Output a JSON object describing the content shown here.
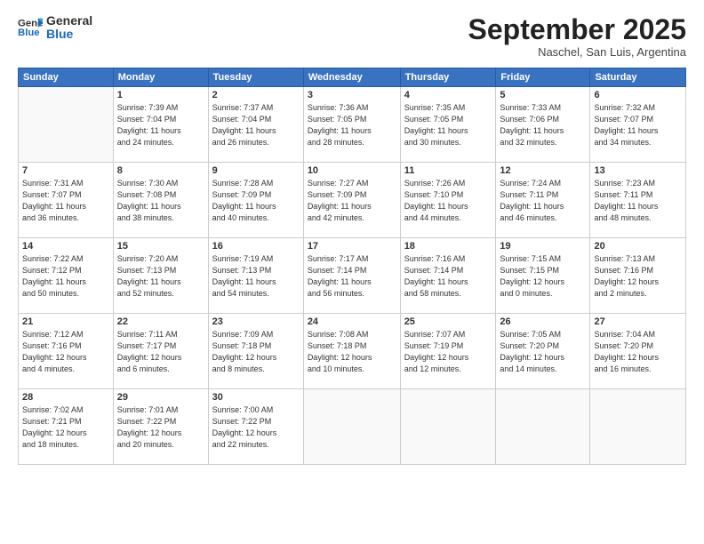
{
  "header": {
    "logo_general": "General",
    "logo_blue": "Blue",
    "month_title": "September 2025",
    "subtitle": "Naschel, San Luis, Argentina"
  },
  "days_of_week": [
    "Sunday",
    "Monday",
    "Tuesday",
    "Wednesday",
    "Thursday",
    "Friday",
    "Saturday"
  ],
  "weeks": [
    [
      {
        "day": "",
        "info": ""
      },
      {
        "day": "1",
        "info": "Sunrise: 7:39 AM\nSunset: 7:04 PM\nDaylight: 11 hours\nand 24 minutes."
      },
      {
        "day": "2",
        "info": "Sunrise: 7:37 AM\nSunset: 7:04 PM\nDaylight: 11 hours\nand 26 minutes."
      },
      {
        "day": "3",
        "info": "Sunrise: 7:36 AM\nSunset: 7:05 PM\nDaylight: 11 hours\nand 28 minutes."
      },
      {
        "day": "4",
        "info": "Sunrise: 7:35 AM\nSunset: 7:05 PM\nDaylight: 11 hours\nand 30 minutes."
      },
      {
        "day": "5",
        "info": "Sunrise: 7:33 AM\nSunset: 7:06 PM\nDaylight: 11 hours\nand 32 minutes."
      },
      {
        "day": "6",
        "info": "Sunrise: 7:32 AM\nSunset: 7:07 PM\nDaylight: 11 hours\nand 34 minutes."
      }
    ],
    [
      {
        "day": "7",
        "info": "Sunrise: 7:31 AM\nSunset: 7:07 PM\nDaylight: 11 hours\nand 36 minutes."
      },
      {
        "day": "8",
        "info": "Sunrise: 7:30 AM\nSunset: 7:08 PM\nDaylight: 11 hours\nand 38 minutes."
      },
      {
        "day": "9",
        "info": "Sunrise: 7:28 AM\nSunset: 7:09 PM\nDaylight: 11 hours\nand 40 minutes."
      },
      {
        "day": "10",
        "info": "Sunrise: 7:27 AM\nSunset: 7:09 PM\nDaylight: 11 hours\nand 42 minutes."
      },
      {
        "day": "11",
        "info": "Sunrise: 7:26 AM\nSunset: 7:10 PM\nDaylight: 11 hours\nand 44 minutes."
      },
      {
        "day": "12",
        "info": "Sunrise: 7:24 AM\nSunset: 7:11 PM\nDaylight: 11 hours\nand 46 minutes."
      },
      {
        "day": "13",
        "info": "Sunrise: 7:23 AM\nSunset: 7:11 PM\nDaylight: 11 hours\nand 48 minutes."
      }
    ],
    [
      {
        "day": "14",
        "info": "Sunrise: 7:22 AM\nSunset: 7:12 PM\nDaylight: 11 hours\nand 50 minutes."
      },
      {
        "day": "15",
        "info": "Sunrise: 7:20 AM\nSunset: 7:13 PM\nDaylight: 11 hours\nand 52 minutes."
      },
      {
        "day": "16",
        "info": "Sunrise: 7:19 AM\nSunset: 7:13 PM\nDaylight: 11 hours\nand 54 minutes."
      },
      {
        "day": "17",
        "info": "Sunrise: 7:17 AM\nSunset: 7:14 PM\nDaylight: 11 hours\nand 56 minutes."
      },
      {
        "day": "18",
        "info": "Sunrise: 7:16 AM\nSunset: 7:14 PM\nDaylight: 11 hours\nand 58 minutes."
      },
      {
        "day": "19",
        "info": "Sunrise: 7:15 AM\nSunset: 7:15 PM\nDaylight: 12 hours\nand 0 minutes."
      },
      {
        "day": "20",
        "info": "Sunrise: 7:13 AM\nSunset: 7:16 PM\nDaylight: 12 hours\nand 2 minutes."
      }
    ],
    [
      {
        "day": "21",
        "info": "Sunrise: 7:12 AM\nSunset: 7:16 PM\nDaylight: 12 hours\nand 4 minutes."
      },
      {
        "day": "22",
        "info": "Sunrise: 7:11 AM\nSunset: 7:17 PM\nDaylight: 12 hours\nand 6 minutes."
      },
      {
        "day": "23",
        "info": "Sunrise: 7:09 AM\nSunset: 7:18 PM\nDaylight: 12 hours\nand 8 minutes."
      },
      {
        "day": "24",
        "info": "Sunrise: 7:08 AM\nSunset: 7:18 PM\nDaylight: 12 hours\nand 10 minutes."
      },
      {
        "day": "25",
        "info": "Sunrise: 7:07 AM\nSunset: 7:19 PM\nDaylight: 12 hours\nand 12 minutes."
      },
      {
        "day": "26",
        "info": "Sunrise: 7:05 AM\nSunset: 7:20 PM\nDaylight: 12 hours\nand 14 minutes."
      },
      {
        "day": "27",
        "info": "Sunrise: 7:04 AM\nSunset: 7:20 PM\nDaylight: 12 hours\nand 16 minutes."
      }
    ],
    [
      {
        "day": "28",
        "info": "Sunrise: 7:02 AM\nSunset: 7:21 PM\nDaylight: 12 hours\nand 18 minutes."
      },
      {
        "day": "29",
        "info": "Sunrise: 7:01 AM\nSunset: 7:22 PM\nDaylight: 12 hours\nand 20 minutes."
      },
      {
        "day": "30",
        "info": "Sunrise: 7:00 AM\nSunset: 7:22 PM\nDaylight: 12 hours\nand 22 minutes."
      },
      {
        "day": "",
        "info": ""
      },
      {
        "day": "",
        "info": ""
      },
      {
        "day": "",
        "info": ""
      },
      {
        "day": "",
        "info": ""
      }
    ]
  ]
}
